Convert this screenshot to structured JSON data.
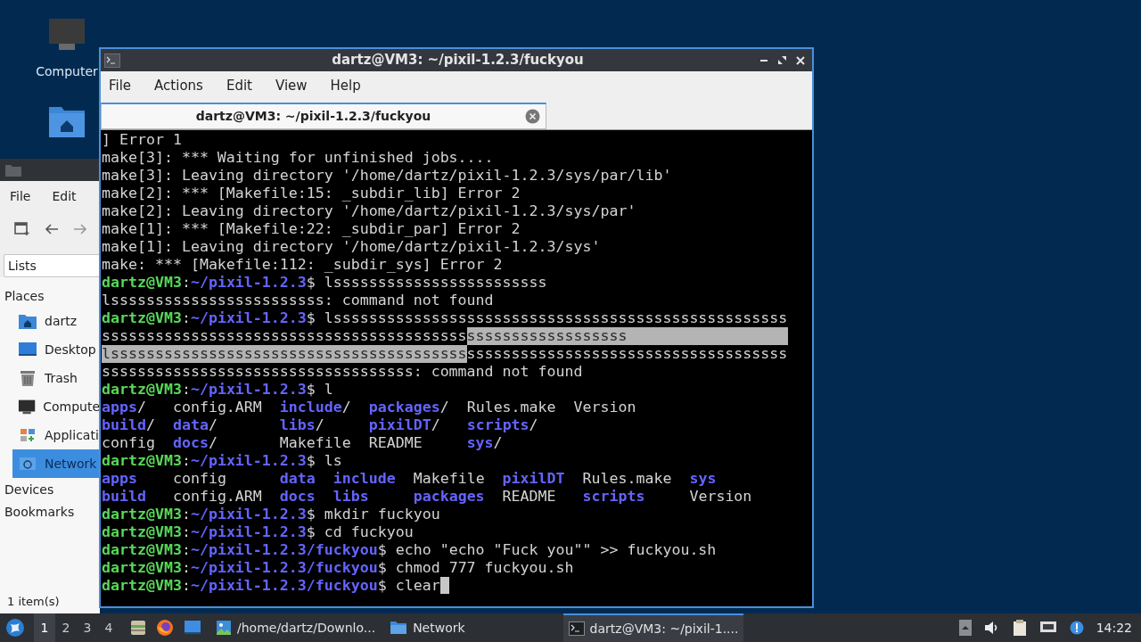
{
  "desktop_icons": [
    {
      "kind": "computer",
      "label": "Computer"
    },
    {
      "kind": "home"
    }
  ],
  "file_manager": {
    "menu": [
      "File",
      "Edit"
    ],
    "view_select": "Lists",
    "sections": [
      {
        "header": "Places",
        "items": [
          {
            "label": "dartz",
            "kind": "home",
            "selected": false
          },
          {
            "label": "Desktop",
            "kind": "desktop",
            "selected": false
          },
          {
            "label": "Trash",
            "kind": "trash",
            "selected": false
          },
          {
            "label": "Compute",
            "kind": "computer",
            "selected": false
          },
          {
            "label": "Applicati",
            "kind": "apps",
            "selected": false
          },
          {
            "label": "Network",
            "kind": "network",
            "selected": true
          }
        ]
      },
      {
        "header": "Devices"
      },
      {
        "header": "Bookmarks"
      }
    ],
    "status": "1 item(s)"
  },
  "terminal": {
    "title": "dartz@VM3: ~/pixil-1.2.3/fuckyou",
    "menu": [
      "File",
      "Actions",
      "Edit",
      "View",
      "Help"
    ],
    "tab": {
      "title": "dartz@VM3: ~/pixil-1.2.3/fuckyou"
    },
    "lines": [
      {
        "segments": [
          {
            "text": "] Error 1",
            "kind": "plain"
          }
        ]
      },
      {
        "segments": [
          {
            "text": "make[3]: *** Waiting for unfinished jobs....",
            "kind": "plain"
          }
        ]
      },
      {
        "segments": [
          {
            "text": "make[3]: Leaving directory '/home/dartz/pixil-1.2.3/sys/par/lib'",
            "kind": "plain"
          }
        ]
      },
      {
        "segments": [
          {
            "text": "make[2]: *** [Makefile:15: _subdir_lib] Error 2",
            "kind": "plain"
          }
        ]
      },
      {
        "segments": [
          {
            "text": "make[2]: Leaving directory '/home/dartz/pixil-1.2.3/sys/par'",
            "kind": "plain"
          }
        ]
      },
      {
        "segments": [
          {
            "text": "make[1]: *** [Makefile:22: _subdir_par] Error 2",
            "kind": "plain"
          }
        ]
      },
      {
        "segments": [
          {
            "text": "make[1]: Leaving directory '/home/dartz/pixil-1.2.3/sys'",
            "kind": "plain"
          }
        ]
      },
      {
        "segments": [
          {
            "text": "make: *** [Makefile:112: _subdir_sys] Error 2",
            "kind": "plain"
          }
        ]
      },
      {
        "segments": [
          {
            "text": "dartz@VM3",
            "kind": "user"
          },
          {
            "text": ":",
            "kind": "plain"
          },
          {
            "text": "~/pixil-1.2.3",
            "kind": "path"
          },
          {
            "text": "$ lssssssssssssssssssssssss",
            "kind": "plain"
          }
        ]
      },
      {
        "segments": [
          {
            "text": "lssssssssssssssssssssssss: command not found",
            "kind": "plain"
          }
        ]
      },
      {
        "segments": [
          {
            "text": "dartz@VM3",
            "kind": "user"
          },
          {
            "text": ":",
            "kind": "plain"
          },
          {
            "text": "~/pixil-1.2.3",
            "kind": "path"
          },
          {
            "text": "$ lsssssssssssssssssssssssssssssssssssssssssssssssssss",
            "kind": "plain"
          }
        ]
      },
      {
        "segments": [
          {
            "text": "sssssssssssssssssssssssssssssssssssssssss",
            "kind": "plain"
          },
          {
            "text": "ssssssssssssssssss",
            "kind": "selected"
          }
        ],
        "selection_to_end": true
      },
      {
        "segments": [
          {
            "text": "lssssssssssssssssssssssssssssssssssssssss",
            "kind": "selected"
          },
          {
            "text": "ssssssssssssssssssssssssssssssssssss",
            "kind": "plain"
          }
        ]
      },
      {
        "segments": [
          {
            "text": "sssssssssssssssssssssssssssssssssss: command not found",
            "kind": "plain"
          }
        ]
      },
      {
        "segments": [
          {
            "text": "dartz@VM3",
            "kind": "user"
          },
          {
            "text": ":",
            "kind": "plain"
          },
          {
            "text": "~/pixil-1.2.3",
            "kind": "path"
          },
          {
            "text": "$ l",
            "kind": "plain"
          }
        ]
      },
      {
        "segments": [
          {
            "text": "apps",
            "kind": "dir"
          },
          {
            "text": "/   config.ARM  ",
            "kind": "plain"
          },
          {
            "text": "include",
            "kind": "dir"
          },
          {
            "text": "/  ",
            "kind": "plain"
          },
          {
            "text": "packages",
            "kind": "dir"
          },
          {
            "text": "/  Rules.make  Version",
            "kind": "plain"
          }
        ]
      },
      {
        "segments": [
          {
            "text": "build",
            "kind": "dir"
          },
          {
            "text": "/  ",
            "kind": "plain"
          },
          {
            "text": "data",
            "kind": "dir"
          },
          {
            "text": "/       ",
            "kind": "plain"
          },
          {
            "text": "libs",
            "kind": "dir"
          },
          {
            "text": "/     ",
            "kind": "plain"
          },
          {
            "text": "pixilDT",
            "kind": "dir"
          },
          {
            "text": "/   ",
            "kind": "plain"
          },
          {
            "text": "scripts",
            "kind": "dir"
          },
          {
            "text": "/",
            "kind": "plain"
          }
        ]
      },
      {
        "segments": [
          {
            "text": "config  ",
            "kind": "plain"
          },
          {
            "text": "docs",
            "kind": "dir"
          },
          {
            "text": "/       Makefile  README     ",
            "kind": "plain"
          },
          {
            "text": "sys",
            "kind": "dir"
          },
          {
            "text": "/",
            "kind": "plain"
          }
        ]
      },
      {
        "segments": [
          {
            "text": "dartz@VM3",
            "kind": "user"
          },
          {
            "text": ":",
            "kind": "plain"
          },
          {
            "text": "~/pixil-1.2.3",
            "kind": "path"
          },
          {
            "text": "$ ls",
            "kind": "plain"
          }
        ]
      },
      {
        "segments": [
          {
            "text": "apps",
            "kind": "dir"
          },
          {
            "text": "    config      ",
            "kind": "plain"
          },
          {
            "text": "data  ",
            "kind": "dir"
          },
          {
            "text": "include",
            "kind": "dir"
          },
          {
            "text": "  Makefile  ",
            "kind": "plain"
          },
          {
            "text": "pixilDT",
            "kind": "dir"
          },
          {
            "text": "  Rules.make  ",
            "kind": "plain"
          },
          {
            "text": "sys",
            "kind": "dir"
          }
        ]
      },
      {
        "segments": [
          {
            "text": "build",
            "kind": "dir"
          },
          {
            "text": "   config.ARM  ",
            "kind": "plain"
          },
          {
            "text": "docs  ",
            "kind": "dir"
          },
          {
            "text": "libs     ",
            "kind": "dir"
          },
          {
            "text": "packages",
            "kind": "dir"
          },
          {
            "text": "  README   ",
            "kind": "plain"
          },
          {
            "text": "scripts",
            "kind": "dir"
          },
          {
            "text": "     Version",
            "kind": "plain"
          }
        ]
      },
      {
        "segments": [
          {
            "text": "dartz@VM3",
            "kind": "user"
          },
          {
            "text": ":",
            "kind": "plain"
          },
          {
            "text": "~/pixil-1.2.3",
            "kind": "path"
          },
          {
            "text": "$ mkdir fuckyou",
            "kind": "plain"
          }
        ]
      },
      {
        "segments": [
          {
            "text": "dartz@VM3",
            "kind": "user"
          },
          {
            "text": ":",
            "kind": "plain"
          },
          {
            "text": "~/pixil-1.2.3",
            "kind": "path"
          },
          {
            "text": "$ cd fuckyou",
            "kind": "plain"
          }
        ]
      },
      {
        "segments": [
          {
            "text": "dartz@VM3",
            "kind": "user"
          },
          {
            "text": ":",
            "kind": "plain"
          },
          {
            "text": "~/pixil-1.2.3/fuckyou",
            "kind": "path"
          },
          {
            "text": "$ echo \"echo \"Fuck you\"\" >> fuckyou.sh",
            "kind": "plain"
          }
        ]
      },
      {
        "segments": [
          {
            "text": "dartz@VM3",
            "kind": "user"
          },
          {
            "text": ":",
            "kind": "plain"
          },
          {
            "text": "~/pixil-1.2.3/fuckyou",
            "kind": "path"
          },
          {
            "text": "$ chmod 777 fuckyou.sh",
            "kind": "plain"
          }
        ]
      },
      {
        "segments": [
          {
            "text": "dartz@VM3",
            "kind": "user"
          },
          {
            "text": ":",
            "kind": "plain"
          },
          {
            "text": "~/pixil-1.2.3/fuckyou",
            "kind": "path"
          },
          {
            "text": "$ clear",
            "kind": "plain"
          }
        ],
        "cursor": true
      }
    ]
  },
  "taskbar": {
    "workspaces": [
      {
        "label": "1",
        "selected": true
      },
      {
        "label": "2",
        "selected": false
      },
      {
        "label": "3",
        "selected": false
      },
      {
        "label": "4",
        "selected": false
      }
    ],
    "launchers": [
      {
        "kind": "files"
      },
      {
        "kind": "browser"
      },
      {
        "kind": "desktop"
      }
    ],
    "tasks": [
      {
        "label": "/home/dartz/Downlo...",
        "kind": "image",
        "selected": false
      },
      {
        "label": "Network",
        "kind": "folder",
        "selected": false
      },
      {
        "label": "dartz@VM3: ~/pixil-1....",
        "kind": "terminal",
        "selected": true
      }
    ],
    "clock": "14:22"
  }
}
